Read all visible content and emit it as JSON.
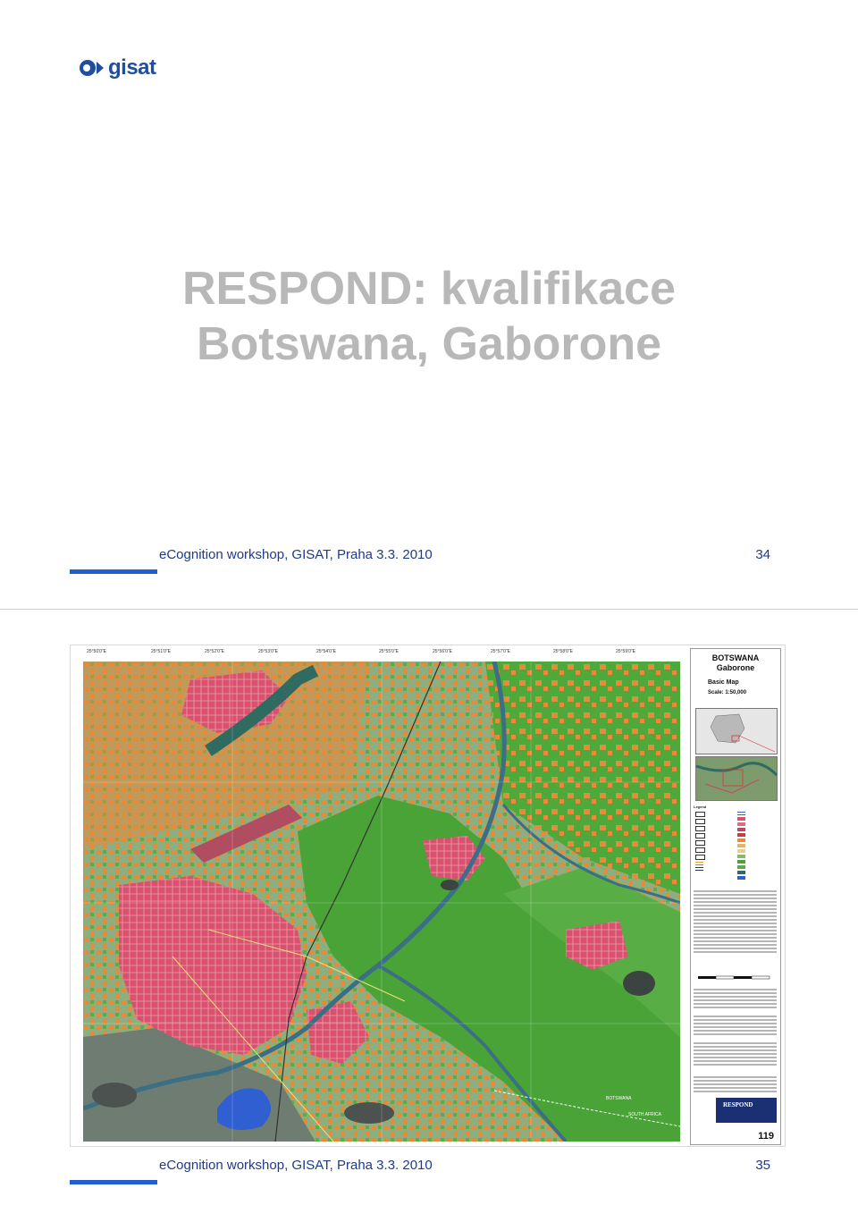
{
  "slide1": {
    "logo_text": "gisat",
    "title_line1": "RESPOND: kvalifikace",
    "title_line2": "Botswana, Gaborone",
    "footer_text": "eCognition workshop, GISAT, Praha 3.3. 2010",
    "page_number": "34"
  },
  "slide2": {
    "footer_text": "eCognition workshop, GISAT, Praha 3.3. 2010",
    "page_number": "35",
    "map": {
      "country": "BOTSWANA",
      "city": "Gaborone",
      "map_type": "Basic Map",
      "scale": "Scale: 1:50,000",
      "border_label_botswana": "BOTSWANA",
      "border_label_south_africa": "SOUTH AFRICA",
      "map_number": "119",
      "logo_text": "RESPOND"
    }
  },
  "colors": {
    "footer_text": "#1e3a8a",
    "footer_rule": "#1f5fd0",
    "logo": "#1d4ea0",
    "title": "#b8b8b8",
    "urban": "#d9516f",
    "cropland": "#e88a3c",
    "forest": "#49a337",
    "water": "#2f5fd1",
    "wetland": "#2f6b60"
  }
}
